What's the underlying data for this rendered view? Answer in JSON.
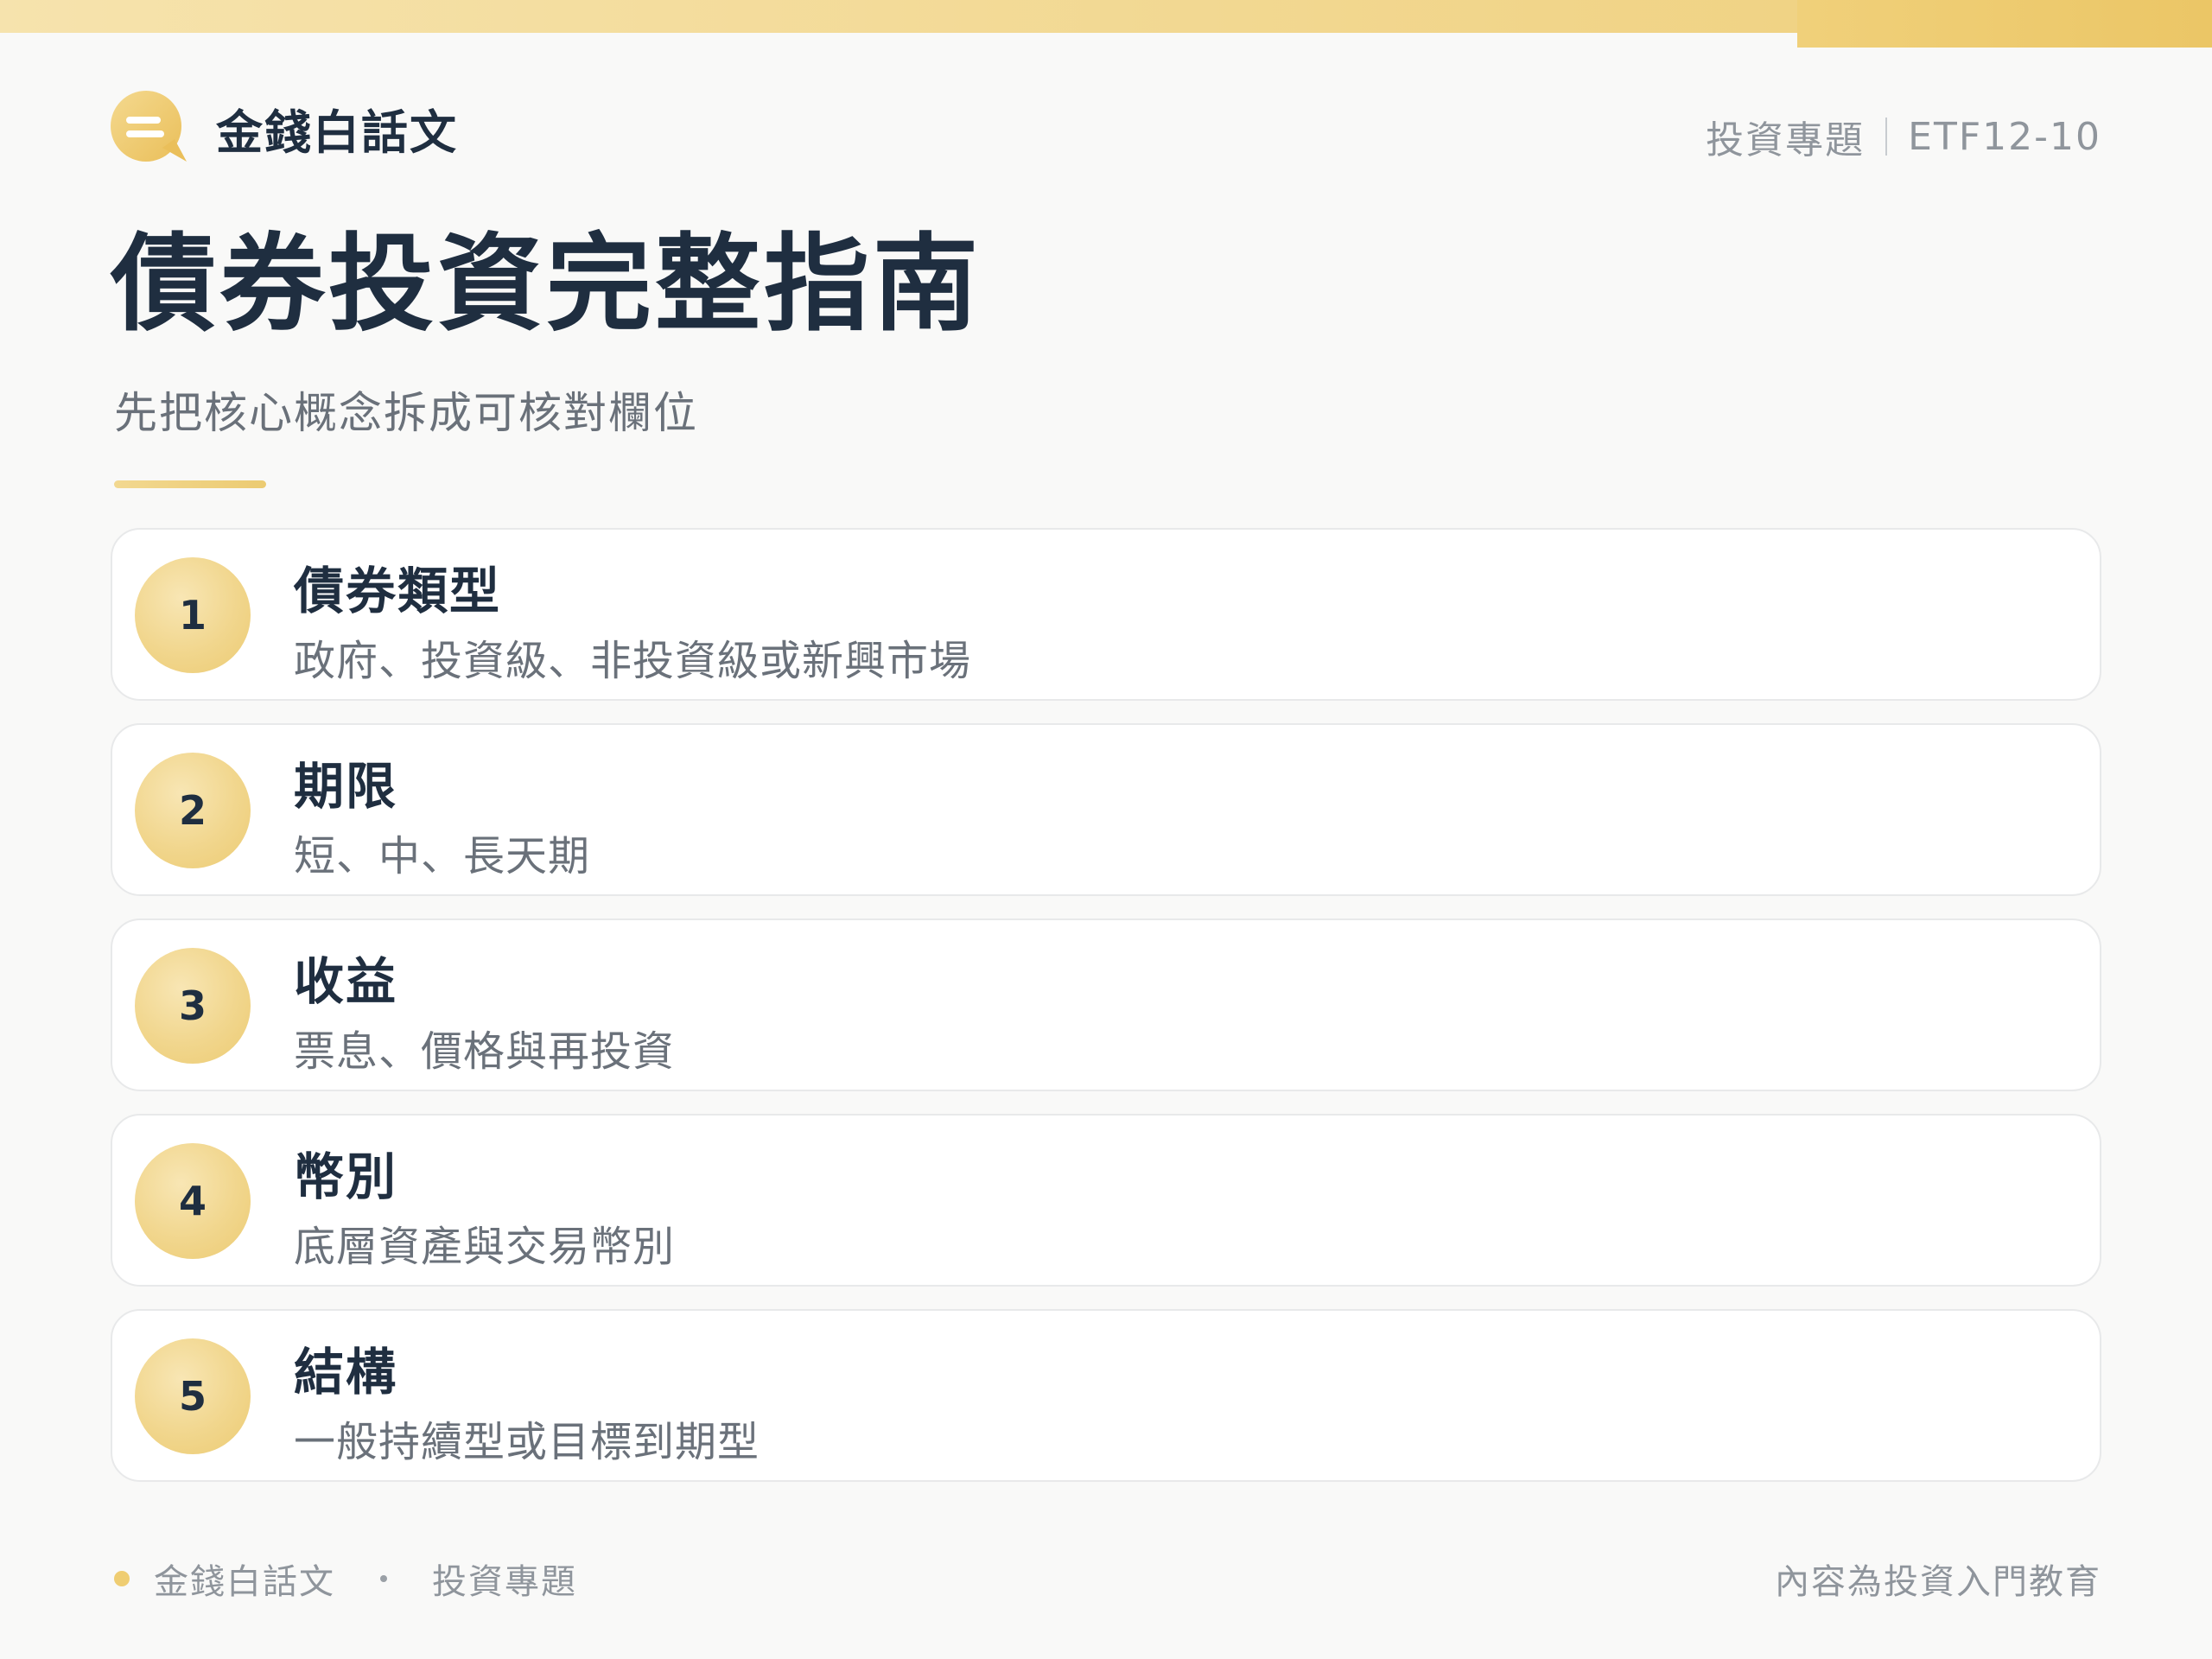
{
  "colors": {
    "accent": "#efcd72",
    "text_dark": "#1f2e40",
    "text_muted": "#6a717a",
    "text_light": "#8f959c",
    "background": "#f9f9f8"
  },
  "header": {
    "logo_icon": "chat-bubble-icon",
    "brand_name": "金錢白話文",
    "section": "投資專題",
    "code": "ETF12-10"
  },
  "main": {
    "title": "債券投資完整指南",
    "subtitle": "先把核心概念拆成可核對欄位",
    "items": [
      {
        "number": "1",
        "title": "債券類型",
        "description": "政府、投資級、非投資級或新興市場"
      },
      {
        "number": "2",
        "title": "期限",
        "description": "短、中、長天期"
      },
      {
        "number": "3",
        "title": "收益",
        "description": "票息、價格與再投資"
      },
      {
        "number": "4",
        "title": "幣別",
        "description": "底層資產與交易幣別"
      },
      {
        "number": "5",
        "title": "結構",
        "description": "一般持續型或目標到期型"
      }
    ]
  },
  "footer": {
    "brand": "金錢白話文",
    "section": "投資專題",
    "note": "內容為投資入門教育"
  }
}
